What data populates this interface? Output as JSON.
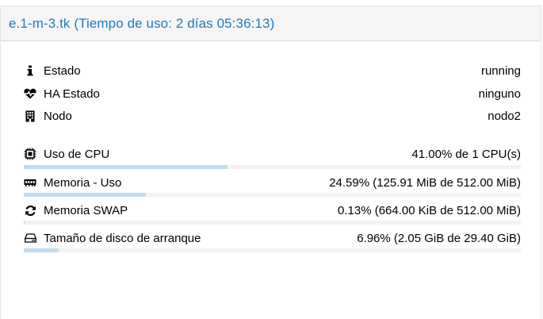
{
  "panel": {
    "title": "e.1-m-3.tk (Tiempo de uso: 2 días 05:36:13)"
  },
  "status": {
    "rows": [
      {
        "icon": "info-icon",
        "label": "Estado",
        "value": "running"
      },
      {
        "icon": "heartbeat-icon",
        "label": "HA Estado",
        "value": "ninguno"
      },
      {
        "icon": "building-icon",
        "label": "Nodo",
        "value": "nodo2"
      }
    ]
  },
  "usage": {
    "rows": [
      {
        "icon": "cpu-icon",
        "label": "Uso de CPU",
        "value": "41.00% de 1 CPU(s)",
        "fraction": 0.41
      },
      {
        "icon": "memory-icon",
        "label": "Memoria - Uso",
        "value": "24.59% (125.91 MiB de 512.00 MiB)",
        "fraction": 0.2459
      },
      {
        "icon": "refresh-icon",
        "label": "Memoria SWAP",
        "value": "0.13% (664.00 KiB de 512.00 MiB)",
        "fraction": 0.0013
      },
      {
        "icon": "hdd-icon",
        "label": "Tamaño de disco de arranque",
        "value": "6.96% (2.05 GiB de 29.40 GiB)",
        "fraction": 0.0696
      }
    ]
  },
  "colors": {
    "title": "#1f7bbd",
    "bar_fill": "#c0dcef",
    "bar_track": "#f2f2f2"
  }
}
